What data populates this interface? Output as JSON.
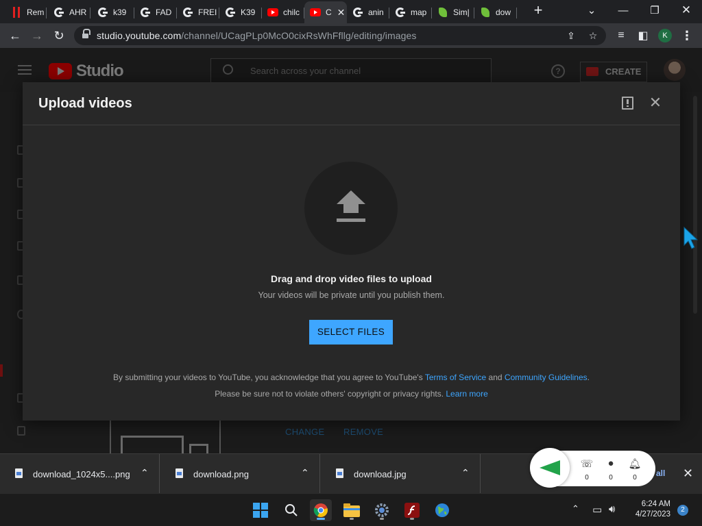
{
  "browser": {
    "tabs": [
      {
        "label": "Rem",
        "icon": "red-bars-icon"
      },
      {
        "label": "AHR",
        "icon": "google-icon"
      },
      {
        "label": "k39",
        "icon": "google-icon"
      },
      {
        "label": "FAD",
        "icon": "google-icon"
      },
      {
        "label": "FREI",
        "icon": "google-icon"
      },
      {
        "label": "K39",
        "icon": "google-icon"
      },
      {
        "label": "chilc",
        "icon": "youtube-icon"
      },
      {
        "label": "C",
        "icon": "youtube-icon",
        "active": true
      },
      {
        "label": "anin",
        "icon": "google-icon"
      },
      {
        "label": "map",
        "icon": "google-icon"
      },
      {
        "label": "Sim|",
        "icon": "leaf-icon"
      },
      {
        "label": "dow",
        "icon": "leaf-icon"
      }
    ],
    "url_host": "studio.youtube.com",
    "url_path": "/channel/UCagPLp0McO0cixRsWhFfllg/editing/images",
    "profile_initial": "K"
  },
  "studio": {
    "logo_text": "Studio",
    "search_placeholder": "Search across your channel",
    "help_label": "?",
    "create_label": "CREATE",
    "change_label": "CHANGE",
    "remove_label": "REMOVE"
  },
  "dialog": {
    "title": "Upload videos",
    "drop_title": "Drag and drop video files to upload",
    "drop_subtitle": "Your videos will be private until you publish them.",
    "select_button": "SELECT FILES",
    "legal_line1_prefix": "By submitting your videos to YouTube, you acknowledge that you agree to YouTube's ",
    "terms_link": "Terms of Service",
    "and_text": " and ",
    "guidelines_link": "Community Guidelines",
    "period": ".",
    "legal_line2": "Please be sure not to violate others' copyright or privacy rights. ",
    "learn_more_link": "Learn more"
  },
  "downloads": {
    "items": [
      {
        "name": "download_1024x5....png"
      },
      {
        "name": "download.png"
      },
      {
        "name": "download.jpg"
      }
    ],
    "show_all": "all",
    "close": "✕"
  },
  "widget": {
    "calls": "0",
    "messages": "0",
    "notifications": "0"
  },
  "taskbar": {
    "time": "6:24 AM",
    "date": "4/27/2023",
    "notification_count": "2"
  },
  "colors": {
    "accent_blue": "#3ea6ff",
    "dialog_bg": "#282828",
    "widget_green": "#22a34a"
  }
}
